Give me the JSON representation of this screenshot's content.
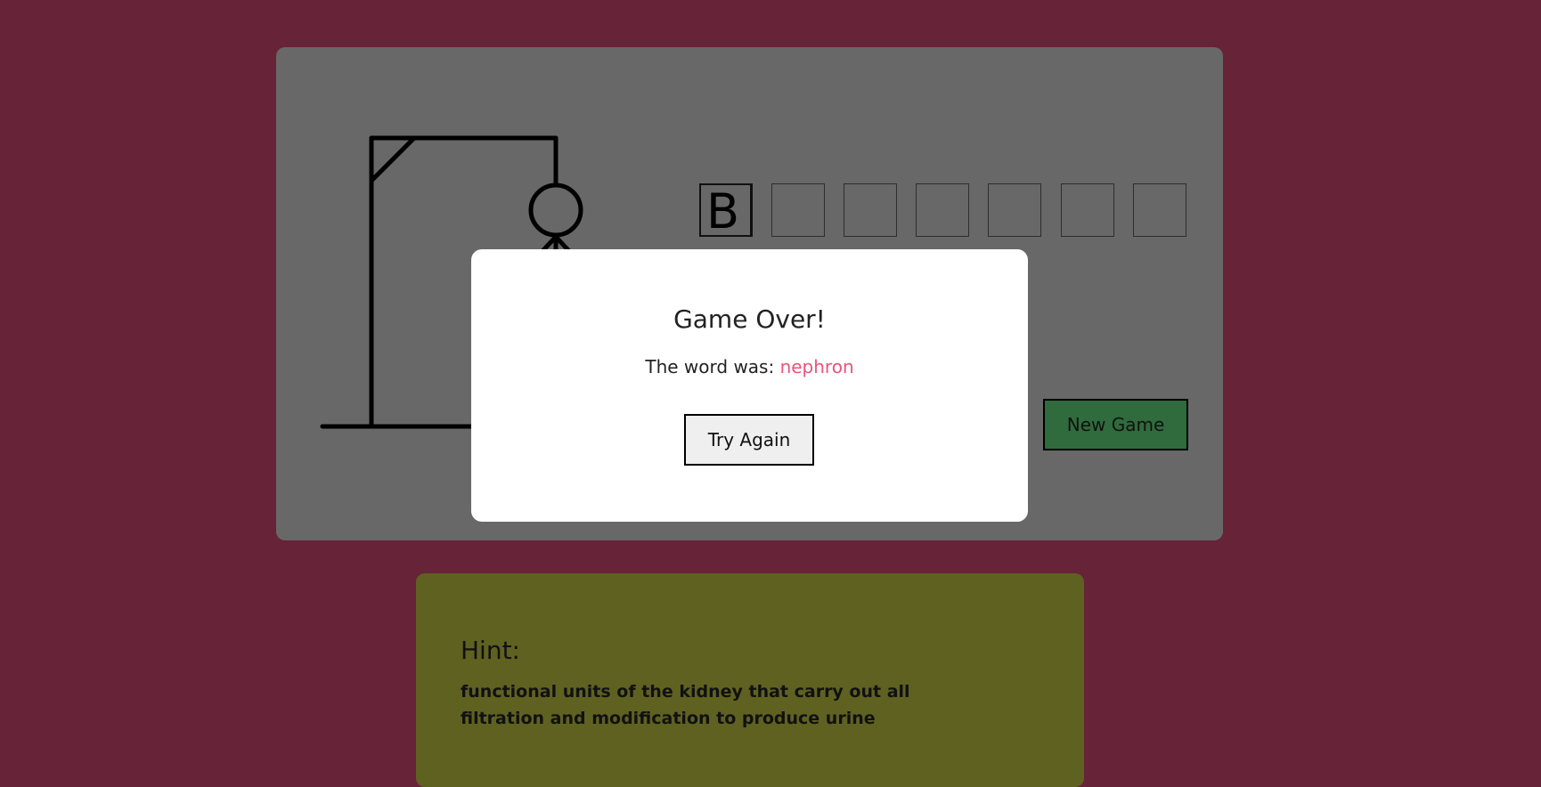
{
  "game": {
    "letters": [
      "B",
      "",
      "",
      "",
      "",
      "",
      ""
    ],
    "new_game_label": "New Game"
  },
  "hint": {
    "title": "Hint:",
    "text": "functional units of the kidney that carry out all filtration and modification to produce urine"
  },
  "modal": {
    "title": "Game Over!",
    "message_prefix": "The word was: ",
    "word": "nephron",
    "button_label": "Try Again"
  },
  "colors": {
    "page_background": "#672337",
    "game_card": "#686868",
    "hint_card": "#5f6121",
    "new_game_button": "#2f6b3c",
    "answer_word": "#e8557a"
  }
}
